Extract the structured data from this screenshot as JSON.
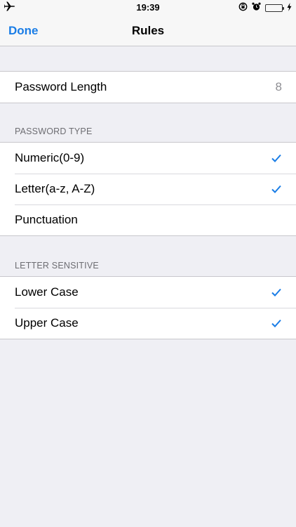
{
  "status_bar": {
    "time": "19:39",
    "airplane_icon": "airplane-icon",
    "icons": [
      "rotation-lock-icon",
      "alarm-icon",
      "battery-icon",
      "charging-icon"
    ]
  },
  "nav": {
    "done_label": "Done",
    "title": "Rules"
  },
  "password_length": {
    "label": "Password Length",
    "value": "8"
  },
  "password_type": {
    "header": "PASSWORD TYPE",
    "items": [
      {
        "label": "Numeric(0-9)",
        "checked": true
      },
      {
        "label": "Letter(a-z, A-Z)",
        "checked": true
      },
      {
        "label": "Punctuation",
        "checked": false
      }
    ]
  },
  "letter_sensitive": {
    "header": "LETTER SENSITIVE",
    "items": [
      {
        "label": "Lower Case",
        "checked": true
      },
      {
        "label": "Upper Case",
        "checked": true
      }
    ]
  },
  "colors": {
    "accent": "#1a7de6",
    "background": "#efeff4",
    "battery": "#4cd964"
  }
}
